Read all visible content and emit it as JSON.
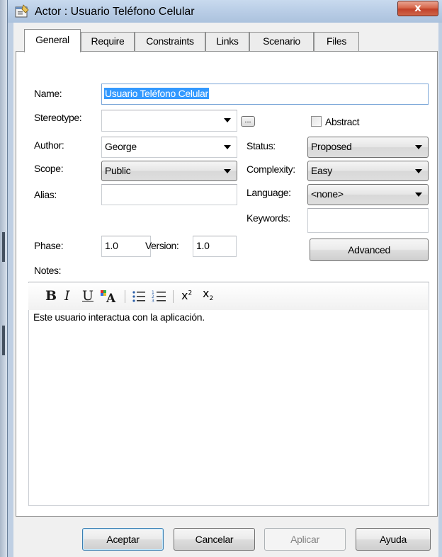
{
  "window": {
    "title": "Actor : Usuario Teléfono Celular",
    "close_label": "x"
  },
  "tabs": [
    {
      "label": "General",
      "active": true
    },
    {
      "label": "Require"
    },
    {
      "label": "Constraints"
    },
    {
      "label": "Links"
    },
    {
      "label": "Scenario"
    },
    {
      "label": "Files"
    }
  ],
  "form": {
    "name_label": "Name:",
    "name_value": "Usuario Teléfono Celular",
    "stereotype_label": "Stereotype:",
    "stereotype_value": "",
    "ellipsis_label": "...",
    "abstract_label": "Abstract",
    "abstract_checked": false,
    "author_label": "Author:",
    "author_value": "George",
    "status_label": "Status:",
    "status_value": "Proposed",
    "scope_label": "Scope:",
    "scope_value": "Public",
    "complexity_label": "Complexity:",
    "complexity_value": "Easy",
    "alias_label": "Alias:",
    "alias_value": "",
    "language_label": "Language:",
    "language_value": "<none>",
    "keywords_label": "Keywords:",
    "keywords_value": "",
    "phase_label": "Phase:",
    "phase_value": "1.0",
    "version_label": "Version:",
    "version_value": "1.0",
    "advanced_label": "Advanced",
    "notes_label": "Notes:"
  },
  "toolbar": {
    "bold": "B",
    "italic": "I",
    "underline": "U",
    "superscript_base": "x",
    "superscript_exp": "2",
    "subscript_base": "x",
    "subscript_sub": "2",
    "icons": [
      "bold-icon",
      "italic-icon",
      "underline-icon",
      "font-color-icon",
      "bullet-list-icon",
      "numbered-list-icon",
      "superscript-icon",
      "subscript-icon"
    ]
  },
  "notes": {
    "text": "Este usuario interactua con la aplicación."
  },
  "buttons": {
    "ok": "Aceptar",
    "cancel": "Cancelar",
    "apply": "Aplicar",
    "help": "Ayuda"
  },
  "colors": {
    "selection": "#3399ff",
    "close_button": "#c1422a",
    "titlebar": "#b9cde6"
  }
}
